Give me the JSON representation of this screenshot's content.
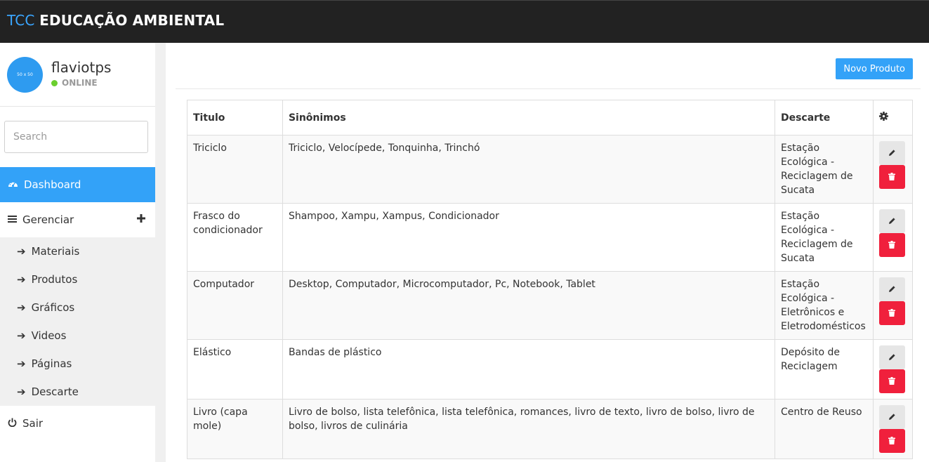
{
  "header": {
    "brand_accent": "TCC",
    "brand_rest": "EDUCAÇÃO AMBIENTAL"
  },
  "user": {
    "avatar_text": "50 x 50",
    "name": "flaviotps",
    "status": "ONLINE"
  },
  "search": {
    "placeholder": "Search"
  },
  "nav": {
    "dashboard": "Dashboard",
    "manage": "Gerenciar",
    "sub_items": [
      "Materiais",
      "Produtos",
      "Gráficos",
      "Videos",
      "Páginas",
      "Descarte"
    ],
    "exit": "Sair"
  },
  "toolbar": {
    "new_button": "Novo Produto"
  },
  "table": {
    "headers": [
      "Titulo",
      "Sinônimos",
      "Descarte"
    ],
    "rows": [
      {
        "titulo": "Triciclo",
        "sinonimos": "Triciclo, Velocípede, Tonquinha, Trinchó",
        "descarte": "Estação Ecológica - Reciclagem de Sucata"
      },
      {
        "titulo": "Frasco do condicionador",
        "sinonimos": "Shampoo, Xampu, Xampus, Condicionador",
        "descarte": "Estação Ecológica - Reciclagem de Sucata"
      },
      {
        "titulo": "Computador",
        "sinonimos": "Desktop, Computador, Microcomputador, Pc, Notebook, Tablet",
        "descarte": "Estação Ecológica - Eletrônicos e Eletrodomésticos"
      },
      {
        "titulo": "Elástico",
        "sinonimos": "Bandas de plástico",
        "descarte": "Depósito de Reciclagem"
      },
      {
        "titulo": "Livro (capa mole)",
        "sinonimos": "Livro de bolso, lista telefônica, lista telefônica, romances, livro de texto, livro de bolso, livro de bolso, livros de culinária",
        "descarte": "Centro de Reuso"
      }
    ]
  },
  "colors": {
    "accent": "#33a2f8",
    "danger": "#f0203c",
    "topbar": "#222222",
    "online": "#6bcf2e"
  }
}
